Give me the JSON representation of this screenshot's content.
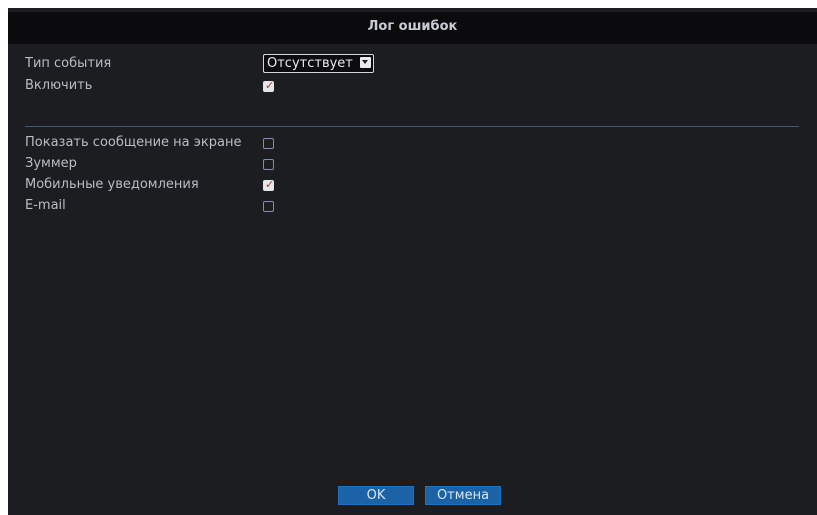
{
  "window": {
    "title": "Лог ошибок"
  },
  "settings": {
    "event_type_label": "Тип события",
    "event_type_value": "Отсутствует",
    "enable_label": "Включить",
    "enable_checked": true
  },
  "actions": [
    {
      "label": "Показать сообщение на экране",
      "checked": false
    },
    {
      "label": "Зуммер",
      "checked": false
    },
    {
      "label": "Мобильные уведомления",
      "checked": true
    },
    {
      "label": "E-mail",
      "checked": false
    }
  ],
  "buttons": {
    "ok_label": "OK",
    "cancel_label": "Отмена"
  },
  "colors": {
    "background": "#1c1d21",
    "titlebar": "#0b0b0d",
    "button_fill": "#1b63a6",
    "checkmark": "#c0312e",
    "divider": "#3b5a7e"
  },
  "icons": {
    "dropdown": "chevron-down-icon",
    "checked": "checkmark-icon"
  }
}
